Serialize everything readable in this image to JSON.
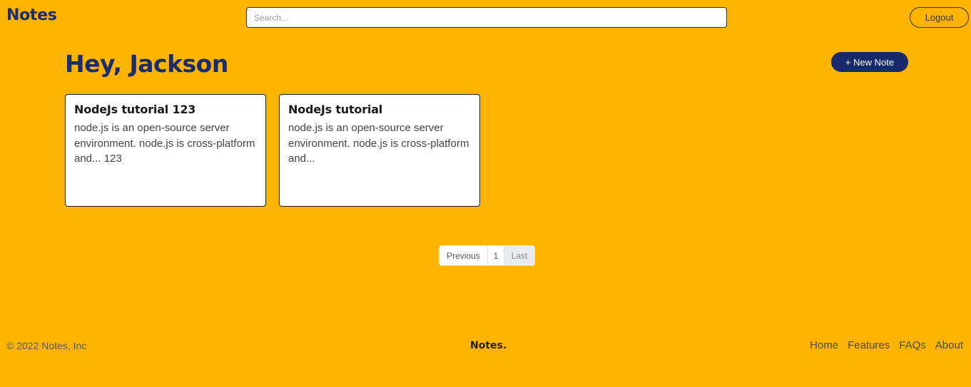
{
  "header": {
    "brand": "Notes",
    "search_placeholder": "Search...",
    "logout_label": "Logout"
  },
  "main": {
    "greeting": "Hey, Jackson",
    "new_note_label": "+ New Note",
    "notes": [
      {
        "title": "NodeJs tutorial 123",
        "body": "node.js is an open-source server environment. node.js is cross-platform and... 123"
      },
      {
        "title": "NodeJs tutorial",
        "body": "node.js is an open-source server environment. node.js is cross-platform and..."
      }
    ],
    "pagination": {
      "previous_label": "Previous",
      "page_label": "1",
      "last_label": "Last"
    }
  },
  "footer": {
    "copyright": "© 2022 Notes, Inc",
    "brand": "Notes.",
    "links": [
      "Home",
      "Features",
      "FAQs",
      "About"
    ]
  },
  "colors": {
    "background": "#FDB400",
    "primary": "#17296A"
  }
}
